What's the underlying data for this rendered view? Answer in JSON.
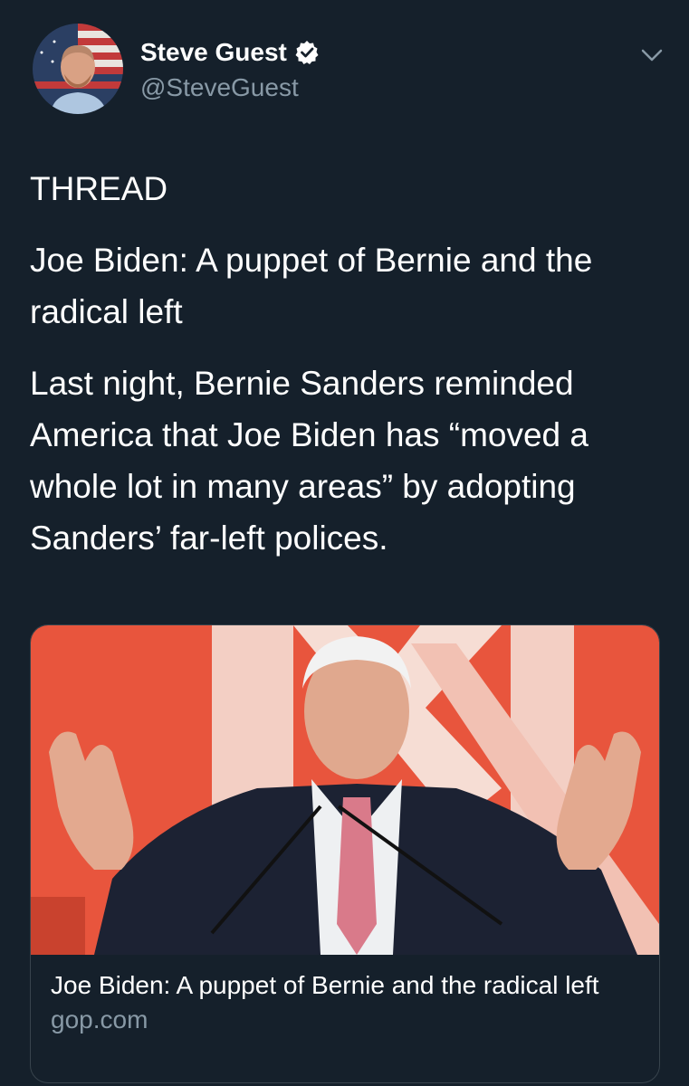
{
  "author": {
    "name": "Steve Guest",
    "handle": "@SteveGuest"
  },
  "icons": {
    "verified": "verified-badge-icon",
    "more": "chevron-down-icon"
  },
  "tweet": {
    "paragraphs": [
      "THREAD",
      "Joe Biden: A puppet of Bernie and the radical left",
      "Last night, Bernie Sanders reminded America that Joe Biden has “moved a whole lot in many areas” by adopting Sanders’ far-left polices."
    ]
  },
  "link_card": {
    "title": "Joe Biden: A puppet of Bernie and the radical left",
    "domain": "gop.com"
  },
  "colors": {
    "background": "#15202b",
    "text": "#ffffff",
    "secondary_text": "#8899a6",
    "border": "#38444d",
    "card_image_bg": "#e8553d"
  }
}
